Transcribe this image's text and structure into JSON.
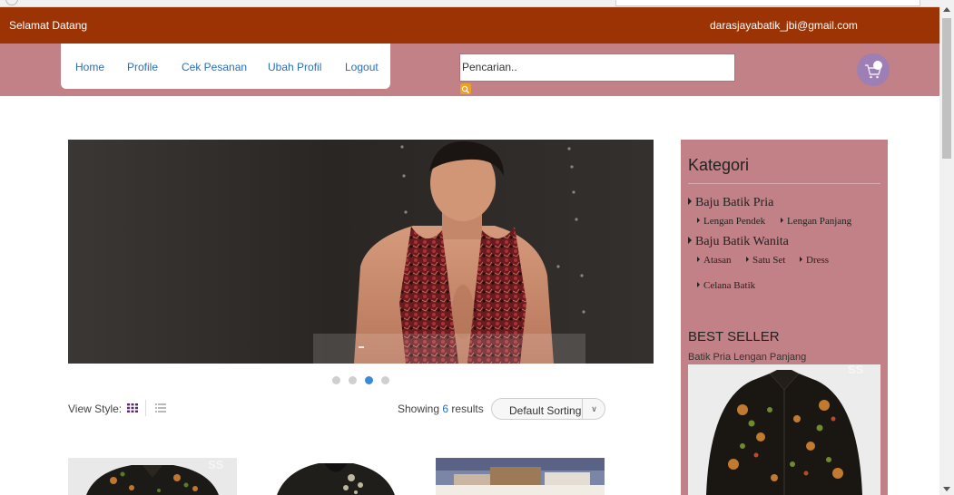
{
  "header": {
    "welcome": "Selamat Datang",
    "email": "darasjayabatik_jbi@gmail.com"
  },
  "nav": {
    "items": [
      "Home",
      "Profile",
      "Cek Pesanan",
      "Ubah Profil",
      "Logout"
    ]
  },
  "search": {
    "placeholder": "Pencarian.."
  },
  "slider": {
    "dot_count": 4,
    "active_dot": 3
  },
  "toolbar": {
    "view_style_label": "View Style:",
    "showing_prefix": "Showing",
    "showing_count": "6",
    "showing_suffix": "results",
    "sorting": "Default Sorting"
  },
  "watermark": "SS",
  "sidebar": {
    "kategori_title": "Kategori",
    "categories": [
      {
        "label": "Baju Batik Pria",
        "subs": [
          "Lengan Pendek",
          "Lengan Panjang"
        ]
      },
      {
        "label": "Baju Batik Wanita",
        "subs": [
          "Atasan",
          "Satu Set",
          "Dress"
        ]
      }
    ],
    "extra_sub": "Celana Batik",
    "best_seller_title": "BEST SELLER",
    "best_seller_item": "Batik Pria Lengan Panjang"
  },
  "colors": {
    "topbar": "#9b3304",
    "navband": "#c28187",
    "link": "#2a6fb5",
    "active_dot": "#3a8ad6",
    "sidebar": "#c28187"
  }
}
